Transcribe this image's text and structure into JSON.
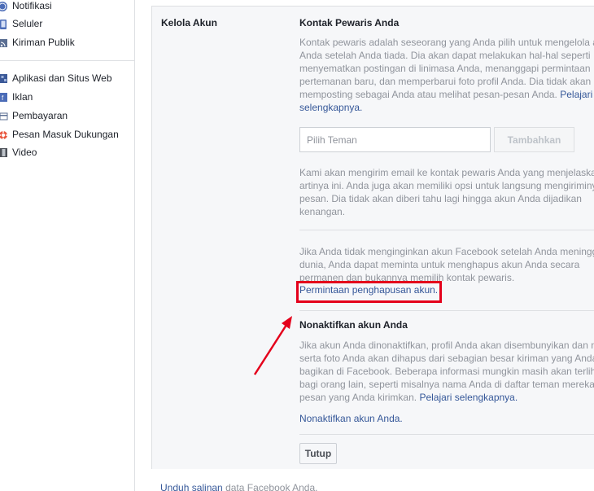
{
  "sidebar": {
    "items": [
      {
        "label": "Notifikasi",
        "icon": "globe-icon"
      },
      {
        "label": "Seluler",
        "icon": "mobile-icon"
      },
      {
        "label": "Kiriman Publik",
        "icon": "rss-icon"
      },
      {
        "label": "Aplikasi dan Situs Web",
        "icon": "apps-icon"
      },
      {
        "label": "Iklan",
        "icon": "ads-icon"
      },
      {
        "label": "Pembayaran",
        "icon": "card-icon"
      },
      {
        "label": "Pesan Masuk Dukungan",
        "icon": "lifebuoy-icon"
      },
      {
        "label": "Video",
        "icon": "film-icon"
      }
    ]
  },
  "settings": {
    "section_label": "Kelola Akun",
    "legacy": {
      "title": "Kontak Pewaris Anda",
      "intro_lines": [
        "Kontak pewaris adalah seseorang yang Anda pilih untuk mengelola akun",
        "Anda setelah Anda tiada. Dia akan dapat melakukan hal-hal seperti",
        "menyematkan postingan di linimasa Anda, menanggapi permintaan",
        "pertemanan baru, dan memperbarui foto profil Anda. Dia tidak akan",
        "memposting sebagai Anda atau melihat pesan-pesan Anda."
      ],
      "learn_more": "Pelajari",
      "learn_more_2": "selengkapnya.",
      "friend_placeholder": "Pilih Teman",
      "add_button": "Tambahkan",
      "email_lines": [
        "Kami akan mengirim email ke kontak pewaris Anda yang menjelaskan",
        "artinya ini. Anda juga akan memiliki opsi untuk langsung mengiriminya",
        "pesan. Dia tidak akan diberi tahu lagi hingga akun Anda dijadikan",
        "kenangan."
      ],
      "delete_lines": [
        "Jika Anda tidak menginginkan akun Facebook setelah Anda meninggal",
        "dunia, Anda dapat meminta untuk menghapus akun Anda secara",
        "permanen dan bukannya memilih kontak pewaris."
      ],
      "delete_link": "Permintaan penghapusan akun."
    },
    "deactivate": {
      "title": "Nonaktifkan akun Anda",
      "lines": [
        "Jika akun Anda dinonaktifkan, profil Anda akan disembunyikan dan nama",
        "serta foto Anda akan dihapus dari sebagian besar kiriman yang Anda",
        "bagikan di Facebook. Beberapa informasi mungkin masih akan terlihat",
        "bagi orang lain, seperti misalnya nama Anda di daftar teman mereka dan",
        "pesan yang Anda kirimkan."
      ],
      "learn_more": "Pelajari selengkapnya.",
      "deactivate_link": "Nonaktifkan akun Anda."
    },
    "close_button": "Tutup"
  },
  "footer": {
    "link": "Unduh salinan",
    "text": " data Facebook Anda."
  },
  "colors": {
    "link": "#365899",
    "muted": "#90949c",
    "highlight": "#e4001b"
  }
}
